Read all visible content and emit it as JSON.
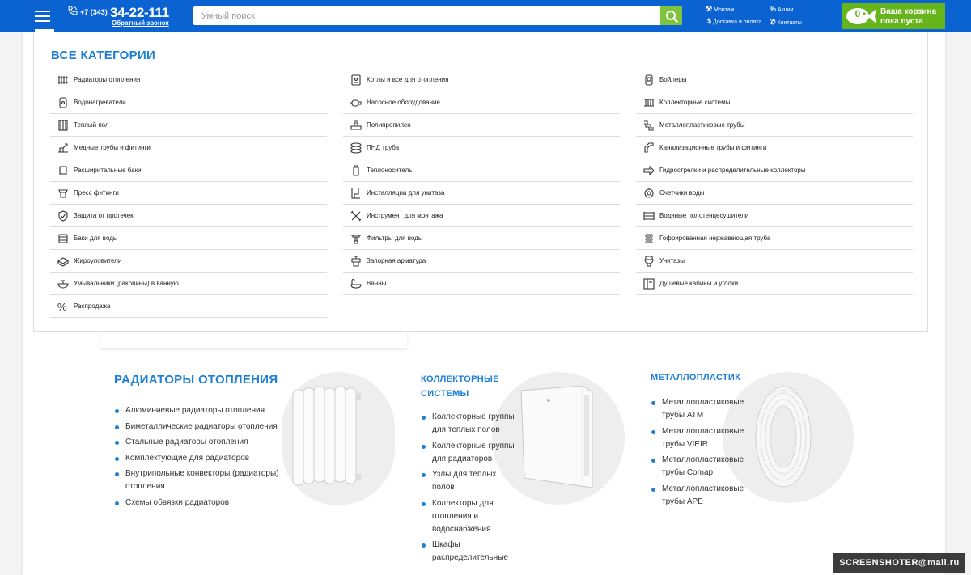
{
  "header": {
    "phone_code": "+7 (343)",
    "phone_number": "34-22-111",
    "callback_label": "Обратный звонок",
    "search_placeholder": "Умный поиск",
    "links": {
      "montage": "Монтаж",
      "delivery": "Доставка и оплата",
      "promo": "Акции",
      "contacts": "Контакты"
    },
    "cart": {
      "count": "0",
      "line1": "Ваша корзина",
      "line2": "пока пуста"
    },
    "colors": {
      "bar": "#0b63d1",
      "accent": "#7fc33e",
      "cart": "#67b51c"
    }
  },
  "menu": {
    "title": "ВСЕ КАТЕГОРИИ",
    "col1": [
      {
        "label": "Радиаторы отопления",
        "icon": "radiator-icon"
      },
      {
        "label": "Водонагреватели",
        "icon": "water-heater-icon"
      },
      {
        "label": "Теплый пол",
        "icon": "warm-floor-icon"
      },
      {
        "label": "Медные трубы и фитинги",
        "icon": "copper-pipe-icon"
      },
      {
        "label": "Расширительные баки",
        "icon": "expansion-tank-icon"
      },
      {
        "label": "Пресс фитинги",
        "icon": "press-fitting-icon"
      },
      {
        "label": "Защита от протечек",
        "icon": "shield-icon"
      },
      {
        "label": "Баки для воды",
        "icon": "water-tank-icon"
      },
      {
        "label": "Жироуловители",
        "icon": "grease-trap-icon"
      },
      {
        "label": "Умывальники (раковины) в ванную",
        "icon": "sink-icon"
      },
      {
        "label": "Распродажа",
        "icon": "percent-icon"
      }
    ],
    "col2": [
      {
        "label": "Котлы и все для отопления",
        "icon": "boiler-icon"
      },
      {
        "label": "Насосное оборудование",
        "icon": "pump-icon"
      },
      {
        "label": "Полипропилен",
        "icon": "polypropylene-icon"
      },
      {
        "label": "ПНД труба",
        "icon": "pipe-coil-icon"
      },
      {
        "label": "Теплоноситель",
        "icon": "coolant-icon"
      },
      {
        "label": "Инсталляции для унитаза",
        "icon": "installation-icon"
      },
      {
        "label": "Инструмент для монтажа",
        "icon": "tools-icon"
      },
      {
        "label": "Фильтры для воды",
        "icon": "filter-icon"
      },
      {
        "label": "Запорная арматура",
        "icon": "valve-icon"
      },
      {
        "label": "Ванны",
        "icon": "bathtub-icon"
      }
    ],
    "col3": [
      {
        "label": "Бойлеры",
        "icon": "boiler-tank-icon"
      },
      {
        "label": "Коллекторные системы",
        "icon": "manifold-icon"
      },
      {
        "label": "Металлопластиковые трубы",
        "icon": "metal-plastic-pipe-icon"
      },
      {
        "label": "Канализационные трубы и фитинги",
        "icon": "sewer-pipe-icon"
      },
      {
        "label": "Гидрострелки и распределительные коллекторы",
        "icon": "arrow-right-icon"
      },
      {
        "label": "Счетчики воды",
        "icon": "water-meter-icon"
      },
      {
        "label": "Водяные полотенцесушители",
        "icon": "towel-dryer-icon"
      },
      {
        "label": "Гофрированная нержавеющая труба",
        "icon": "corrugated-pipe-icon"
      },
      {
        "label": "Унитазы",
        "icon": "toilet-icon"
      },
      {
        "label": "Душевые кабины и уголки",
        "icon": "shower-icon"
      }
    ]
  },
  "categories": {
    "radiators": {
      "title": "РАДИАТОРЫ ОТОПЛЕНИЯ",
      "items": [
        "Алюминиевые радиаторы отопления",
        "Биметаллические радиаторы отопления",
        "Стальные радиаторы отопления",
        "Комплектующие для радиаторов",
        "Внутрипольные конвекторы (радиаторы) отопления",
        "Схемы обвязки радиаторов"
      ]
    },
    "collectors": {
      "title": "КОЛЛЕКТОРНЫЕ СИСТЕМЫ",
      "items": [
        "Коллекторные группы для теплых полов",
        "Коллекторные группы для радиаторов",
        "Узлы для теплых полов",
        "Коллекторы для отопления и водоснабжения",
        "Шкафы распределительные"
      ]
    },
    "metalplastic": {
      "title": "МЕТАЛЛОПЛАСТИК",
      "items": [
        "Металлопластиковые трубы АТМ",
        "Металлопластиковые трубы VIEIR",
        "Металлопластиковые трубы Comap",
        "Металлопластиковые трубы APE"
      ]
    }
  },
  "watermark": "SCREENSHOTER@mail.ru"
}
